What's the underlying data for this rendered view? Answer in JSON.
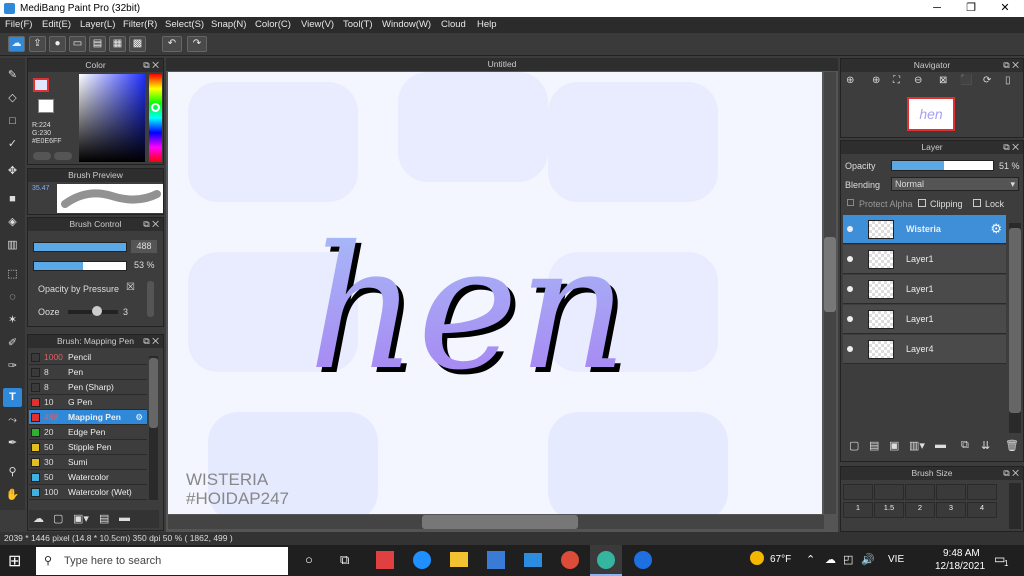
{
  "window": {
    "title": "MediBang Paint Pro (32bit)",
    "minimize": "─",
    "maximize": "❐",
    "close": "✕"
  },
  "menu": [
    "File(F)",
    "Edit(E)",
    "Layer(L)",
    "Filter(R)",
    "Select(S)",
    "Snap(N)",
    "Color(C)",
    "View(V)",
    "Tool(T)",
    "Window(W)",
    "Cloud",
    "Help"
  ],
  "toolbar_icons": [
    "cloud-icon",
    "export-icon",
    "chat-icon",
    "comment-icon",
    "document-icon",
    "grid-icon",
    "tiles-icon",
    "undo-icon",
    "redo-icon"
  ],
  "color_panel": {
    "title": "Color",
    "r": "R:224",
    "g": "G:230",
    "hex": "#E0E6FF",
    "primary": "#e0e6ff",
    "secondary": "#ffffff"
  },
  "brush_preview": {
    "title": "Brush Preview",
    "size": "35.47"
  },
  "brush_control": {
    "title": "Brush Control",
    "size_value": "488",
    "opacity_value": "53 %",
    "size_fill": 1.0,
    "opacity_fill": 0.53,
    "pressure_label": "Opacity by Pressure",
    "pressure_check": "☒",
    "ooze_label": "Ooze",
    "ooze_value": "3"
  },
  "brush_list": {
    "title": "Brush: Mapping Pen",
    "items": [
      {
        "size": "1000",
        "name": "Pencil",
        "color": "#3a3a3a",
        "size_color": "#e06060"
      },
      {
        "size": "8",
        "name": "Pen",
        "color": "#3a3a3a",
        "size_color": "#dddddd"
      },
      {
        "size": "8",
        "name": "Pen (Sharp)",
        "color": "#3a3a3a",
        "size_color": "#dddddd"
      },
      {
        "size": "10",
        "name": "G Pen",
        "color": "#e03030",
        "size_color": "#dddddd"
      },
      {
        "size": "488",
        "name": "Mapping Pen",
        "color": "#e03030",
        "size_color": "#e06060"
      },
      {
        "size": "20",
        "name": "Edge Pen",
        "color": "#30b030",
        "size_color": "#dddddd"
      },
      {
        "size": "50",
        "name": "Stipple Pen",
        "color": "#e0c020",
        "size_color": "#dddddd"
      },
      {
        "size": "30",
        "name": "Sumi",
        "color": "#e0c020",
        "size_color": "#dddddd"
      },
      {
        "size": "50",
        "name": "Watercolor",
        "color": "#40b0e0",
        "size_color": "#dddddd"
      },
      {
        "size": "100",
        "name": "Watercolor (Wet)",
        "color": "#40b0e0",
        "size_color": "#dddddd"
      }
    ]
  },
  "canvas": {
    "title": "Untitled",
    "art_text": "hen",
    "watermark_line1": "WISTERIA",
    "watermark_line2": "#HOIDAP247"
  },
  "navigator": {
    "title": "Navigator",
    "thumb_text": "hen"
  },
  "layer_panel": {
    "title": "Layer",
    "opacity_label": "Opacity",
    "opacity_value": "51 %",
    "opacity_fill": 0.51,
    "blending_label": "Blending",
    "blending_value": "Normal",
    "protect_alpha": "Protect Alpha",
    "clipping": "Clipping",
    "lock": "Lock",
    "layers": [
      {
        "name": "Wisteria",
        "selected": true
      },
      {
        "name": "Layer1",
        "selected": false
      },
      {
        "name": "Layer1",
        "selected": false
      },
      {
        "name": "Layer1",
        "selected": false
      },
      {
        "name": "Layer4",
        "selected": false
      }
    ]
  },
  "brush_size_panel": {
    "title": "Brush Size",
    "values": [
      "1",
      "1.5",
      "2",
      "3",
      "4"
    ]
  },
  "status": "2039 * 1446 pixel   (14.8 * 10.5cm)   350 dpi   50 %   ( 1862, 499 )",
  "taskbar": {
    "search_placeholder": "Type here to search",
    "weather": "67°F",
    "lang": "VIE",
    "time": "9:48 AM",
    "date": "12/18/2021",
    "notif": "1"
  }
}
